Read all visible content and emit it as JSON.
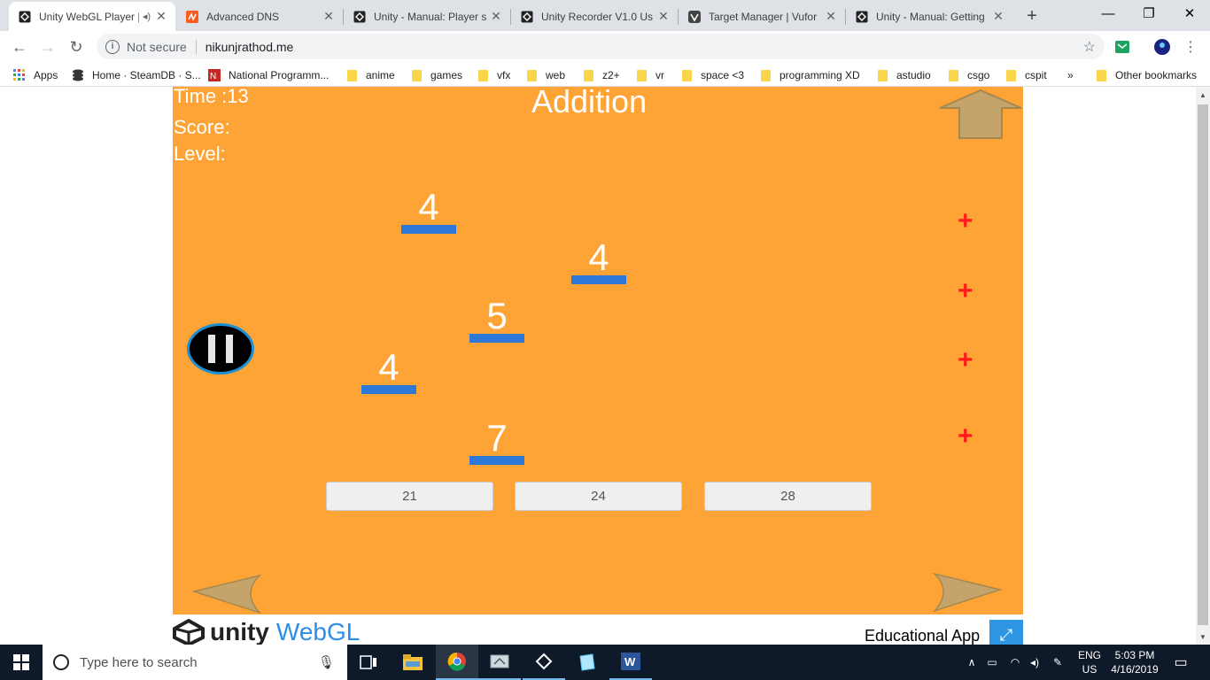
{
  "browser": {
    "tabs": [
      {
        "title": "Unity WebGL Player | ",
        "active": true,
        "icon": "unity-icon"
      },
      {
        "title": "Advanced DNS",
        "active": false,
        "icon": "namecheap-icon"
      },
      {
        "title": "Unity - Manual: Player s",
        "active": false,
        "icon": "unity-icon"
      },
      {
        "title": "Unity Recorder V1.0 Us",
        "active": false,
        "icon": "unity-icon"
      },
      {
        "title": "Target Manager | Vufor",
        "active": false,
        "icon": "vuforia-icon"
      },
      {
        "title": "Unity - Manual: Getting",
        "active": false,
        "icon": "unity-icon"
      }
    ],
    "security_label": "Not secure",
    "url": "nikunjrathod.me",
    "bookmarks": [
      {
        "label": "Apps",
        "icon": "apps-grid-icon"
      },
      {
        "label": "Home · SteamDB · S...",
        "icon": "steamdb-icon"
      },
      {
        "label": "National Programm...",
        "icon": "np-icon"
      },
      {
        "label": "anime",
        "icon": "folder-icon"
      },
      {
        "label": "games",
        "icon": "folder-icon"
      },
      {
        "label": "vfx",
        "icon": "folder-icon"
      },
      {
        "label": "web",
        "icon": "folder-icon"
      },
      {
        "label": "z2+",
        "icon": "folder-icon"
      },
      {
        "label": "vr",
        "icon": "folder-icon"
      },
      {
        "label": "space <3",
        "icon": "folder-icon"
      },
      {
        "label": "programming XD",
        "icon": "folder-icon"
      },
      {
        "label": "astudio",
        "icon": "folder-icon"
      },
      {
        "label": "csgo",
        "icon": "folder-icon"
      },
      {
        "label": "cspit",
        "icon": "folder-icon"
      }
    ],
    "bookmarks_overflow": "»",
    "other_bookmarks": "Other bookmarks"
  },
  "game": {
    "time_text": "Time :13",
    "score_label": "Score:",
    "level_label": "Level:",
    "title": "Addition",
    "numbers": [
      "4",
      "4",
      "5",
      "4",
      "7"
    ],
    "plus_signs": [
      "+",
      "+",
      "+",
      "+"
    ],
    "answers": [
      "21",
      "24",
      "28"
    ],
    "colors": {
      "background": "#fea436",
      "bar": "#2d78d8",
      "plus": "#ff1b1b",
      "arrow": "#c4a46a"
    }
  },
  "footer": {
    "unity_text": "unity",
    "webgl_text": "WebGL",
    "app_name": "Educational App"
  },
  "taskbar": {
    "search_placeholder": "Type here to search",
    "lang_top": "ENG",
    "lang_bottom": "US",
    "time": "5:03 PM",
    "date": "4/16/2019"
  }
}
